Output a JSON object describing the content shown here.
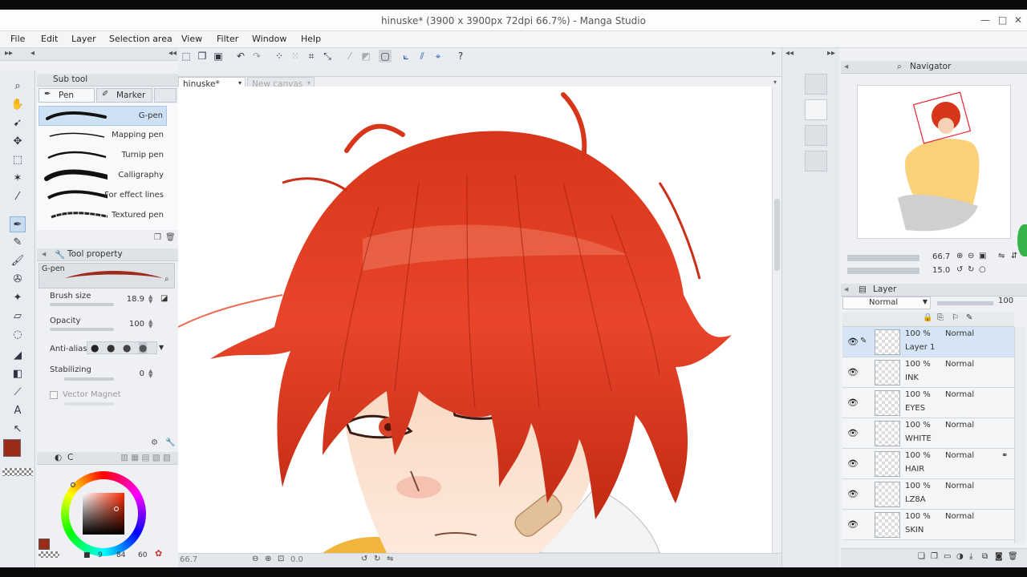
{
  "window": {
    "title": "hinuske* (3900 x 3900px 72dpi 66.7%)  - Manga Studio",
    "controls": [
      "—",
      "□",
      "✕"
    ]
  },
  "menu": [
    "File",
    "Edit",
    "Layer",
    "Selection area",
    "View",
    "Filter",
    "Window",
    "Help"
  ],
  "subtool": {
    "title": "Sub tool",
    "tabs": [
      "Pen",
      "Marker"
    ],
    "brushes": [
      "G-pen",
      "Mapping pen",
      "Turnip pen",
      "Calligraphy",
      "For effect lines",
      "Textured pen"
    ],
    "selected": "G-pen"
  },
  "tool_property": {
    "title": "Tool property",
    "preset": "G-pen",
    "brush_size_label": "Brush size",
    "brush_size": "18.9",
    "opacity_label": "Opacity",
    "opacity": "100",
    "antialias_label": "Anti-alias",
    "stabilizing_label": "Stabilizing",
    "stabilizing": "0",
    "vector_magnet_label": "Vector Magnet"
  },
  "color": {
    "main": "#9b2c1b",
    "tab_label": "C",
    "readout": [
      "9",
      "84",
      "60"
    ]
  },
  "canvas": {
    "tabs": [
      "hinuske*",
      "New canvas"
    ],
    "zoom": "66.7",
    "rotation": "0.0"
  },
  "navigator": {
    "title": "Navigator",
    "zoom": "66.7",
    "angle": "15.0"
  },
  "layer_panel": {
    "title": "Layer",
    "blend_mode": "Normal",
    "opacity": "100",
    "layers": [
      {
        "opacity": "100 %",
        "mode": "Normal",
        "name": "Layer 1"
      },
      {
        "opacity": "100 %",
        "mode": "Normal",
        "name": "INK"
      },
      {
        "opacity": "100 %",
        "mode": "Normal",
        "name": "EYES"
      },
      {
        "opacity": "100 %",
        "mode": "Normal",
        "name": "WHITE"
      },
      {
        "opacity": "100 %",
        "mode": "Normal",
        "name": "HAIR"
      },
      {
        "opacity": "100 %",
        "mode": "Normal",
        "name": "LZ8A"
      },
      {
        "opacity": "100 %",
        "mode": "Normal",
        "name": "SKIN"
      }
    ]
  },
  "icons": {
    "zoom": "magnifier-icon",
    "hand": "hand-icon",
    "rotate": "rotate-icon",
    "eye": "eye-icon"
  }
}
